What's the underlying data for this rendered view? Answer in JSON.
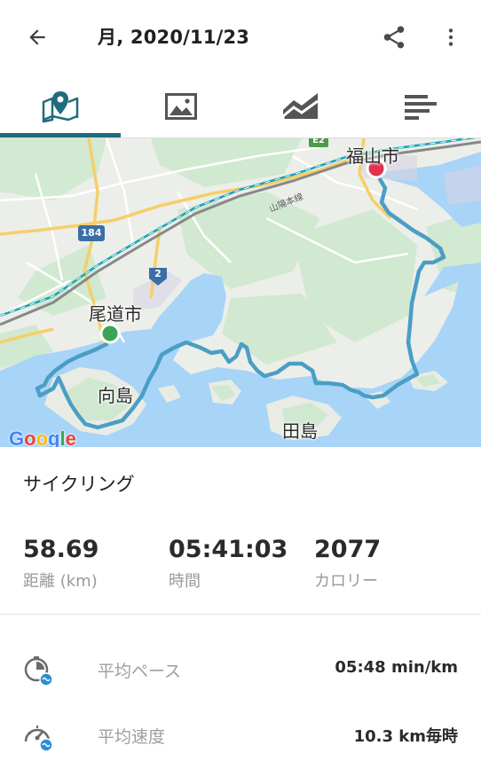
{
  "header": {
    "title": "月, 2020/11/23"
  },
  "tabs": [
    {
      "name": "map",
      "icon": "map-pin-icon",
      "active": true
    },
    {
      "name": "photos",
      "icon": "image-icon",
      "active": false
    },
    {
      "name": "chart",
      "icon": "area-chart-icon",
      "active": false
    },
    {
      "name": "splits",
      "icon": "bar-list-icon",
      "active": false
    }
  ],
  "map": {
    "labels": {
      "fukuyama": "福山市",
      "onomichi": "尾道市",
      "mukaishima": "向島",
      "tashima": "田島",
      "sanyo_line": "山陽本線",
      "route_184": "184",
      "route_2": "2",
      "route_e2": "E2"
    },
    "attribution": "Google",
    "colors": {
      "water": "#a8d4f7",
      "route": "#4a9ec4",
      "start": "#3aa655",
      "end": "#e0334f"
    }
  },
  "activity": {
    "type": "サイクリング"
  },
  "stats": [
    {
      "value": "58.69",
      "label": "距離 (km)"
    },
    {
      "value": "05:41:03",
      "label": "時間"
    },
    {
      "value": "2077",
      "label": "カロリー"
    }
  ],
  "details": [
    {
      "icon": "pace-clock-icon",
      "label": "平均ペース",
      "value": "05:48 min/km"
    },
    {
      "icon": "speedometer-icon",
      "label": "平均速度",
      "value": "10.3 km毎時"
    }
  ]
}
